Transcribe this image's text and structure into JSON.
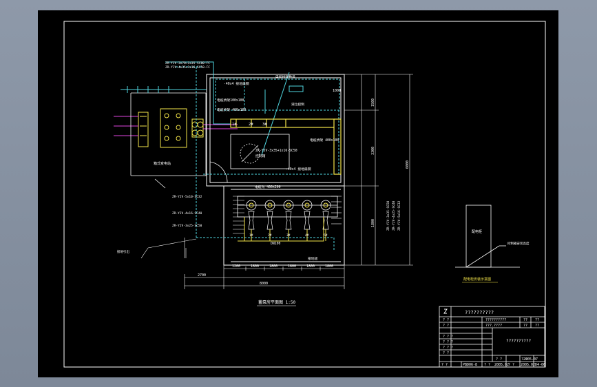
{
  "drawing": {
    "plan_title": "蓄泵房平面图  1:50",
    "notes": {
      "cable_route_left_1": "ZR-YJV-3x70+1x35-SC80-FC",
      "cable_route_left_2": "ZR-YJV-4x35+1x16-SC50-FC",
      "outdoor_transformer": "箱式变电站",
      "ground_bar_top": "-40x4 接地扁钢",
      "ground_flat_steel": "电缆桥架敷设",
      "panel_note": "液位控制",
      "tray_note": "电缆桥架100x100",
      "cable_tray": "电缆桥架 400x100",
      "cable_tray_2": "电缆桥架 400x100",
      "pump_power": "ZR-YJV-3x35+1x16-SC50",
      "distribution_box": "控制箱",
      "ground_bar_mid": "-40x4 接地扁钢",
      "vent_note": "电缆沟 400x200",
      "cable_below_1": "ZR-YJV-5x10-SC32",
      "cable_below_2": "ZR-YJV-4x16-SC40",
      "cable_below_3": "ZR-YJV-3x25-SC50",
      "ground_note": "接地极",
      "pipe_note": "DN100",
      "left_small": "接地引出",
      "right_vertical_1": "ZR-YJV-3x35-SC50",
      "right_vertical_2": "ZR-YJV-4x25-SC40",
      "right_vertical_3": "ZR-YJV-5x16-SC32",
      "side_box_label": "配电柜",
      "side_leader": "控制箱安装高度",
      "side_caption": "配电柜安装示意图"
    },
    "dims": {
      "bottom": [
        "1200",
        "1800",
        "1800",
        "1800",
        "1800",
        "1800"
      ],
      "bottom_left": "2700",
      "bottom_total": "8000",
      "right_1": "1500",
      "right_2": "3300",
      "right_3": "1800",
      "right_total": "6000",
      "top_right": "1000"
    },
    "pump_labels": [
      "1#",
      "2#",
      "3#",
      "4#",
      "5#"
    ],
    "room_labels": [
      "1#",
      "2#",
      "3#"
    ]
  },
  "title_block": {
    "title": "??????????",
    "row1": [
      "??????????",
      "??",
      "??"
    ],
    "row2": [
      "???.????",
      "??",
      "??"
    ],
    "drawing_name": "??????????",
    "left_labels": [
      "? ?",
      "? ?",
      "? ? ?",
      "? ? ?",
      "? ? ?",
      "? ?"
    ],
    "bottom_cells": [
      "? ?",
      "? ?"
    ],
    "bottom_row": [
      "? ?",
      "PBD06-8",
      "? ?",
      "2005.02",
      "? ?",
      "2005.02",
      "D4-06"
    ],
    "date": "2005.07"
  }
}
